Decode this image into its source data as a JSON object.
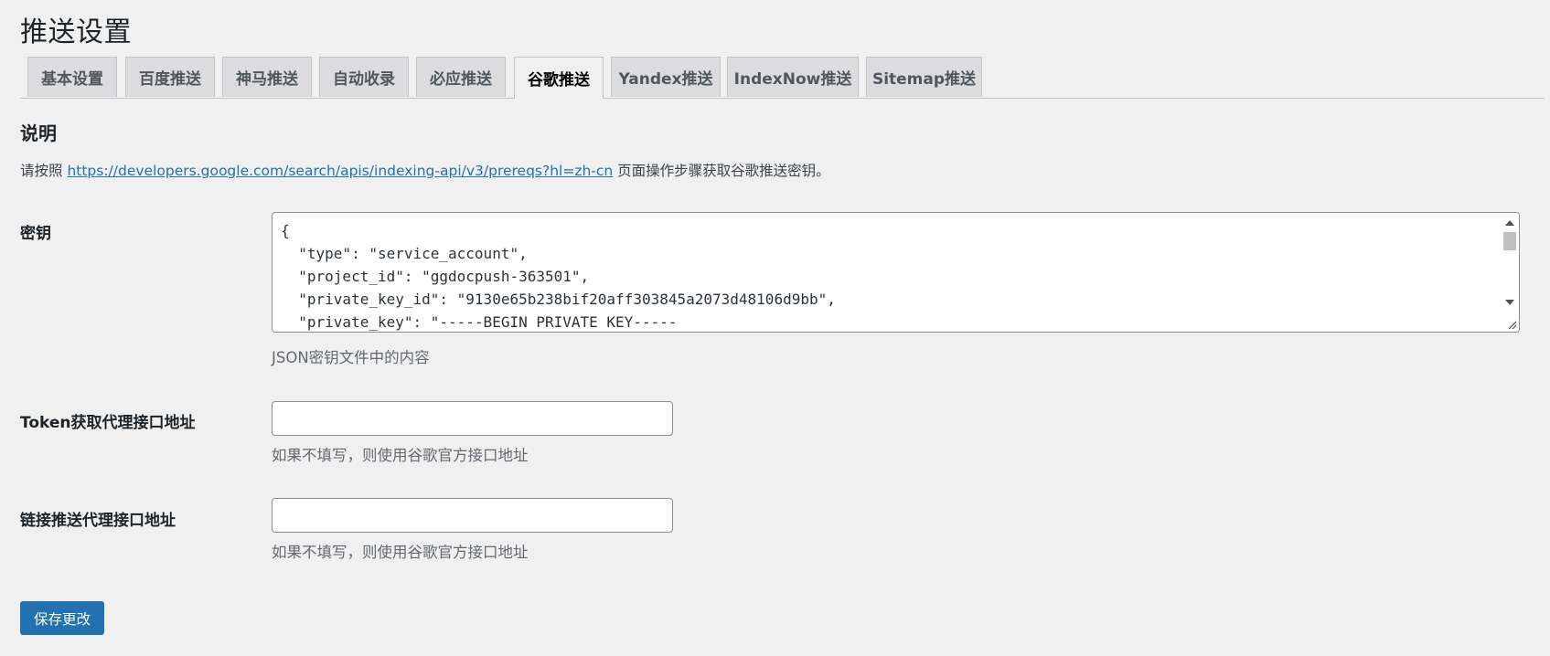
{
  "page": {
    "title": "推送设置"
  },
  "tabs": [
    {
      "label": "基本设置",
      "active": false
    },
    {
      "label": "百度推送",
      "active": false
    },
    {
      "label": "神马推送",
      "active": false
    },
    {
      "label": "自动收录",
      "active": false
    },
    {
      "label": "必应推送",
      "active": false
    },
    {
      "label": "谷歌推送",
      "active": true
    },
    {
      "label": "Yandex推送",
      "active": false
    },
    {
      "label": "IndexNow推送",
      "active": false
    },
    {
      "label": "Sitemap推送",
      "active": false
    }
  ],
  "section": {
    "title": "说明",
    "desc_prefix": "请按照 ",
    "desc_link": "https://developers.google.com/search/apis/indexing-api/v3/prereqs?hl=zh-cn",
    "desc_suffix": " 页面操作步骤获取谷歌推送密钥。"
  },
  "fields": {
    "key": {
      "label": "密钥",
      "value": "{\n  \"type\": \"service_account\",\n  \"project_id\": \"ggdocpush-363501\",\n  \"private_key_id\": \"9130e65b238bif20aff303845a2073d48106d9bb\",\n  \"private_key\": \"-----BEGIN PRIVATE KEY-----",
      "help": "JSON密钥文件中的内容"
    },
    "token_proxy": {
      "label": "Token获取代理接口地址",
      "value": "",
      "help": "如果不填写，则使用谷歌官方接口地址"
    },
    "push_proxy": {
      "label": "链接推送代理接口地址",
      "value": "",
      "help": "如果不填写，则使用谷歌官方接口地址"
    }
  },
  "actions": {
    "save_label": "保存更改"
  },
  "colors": {
    "accent": "#2271b1",
    "background": "#f0f0f1",
    "tab_inactive": "#dcdcde"
  }
}
